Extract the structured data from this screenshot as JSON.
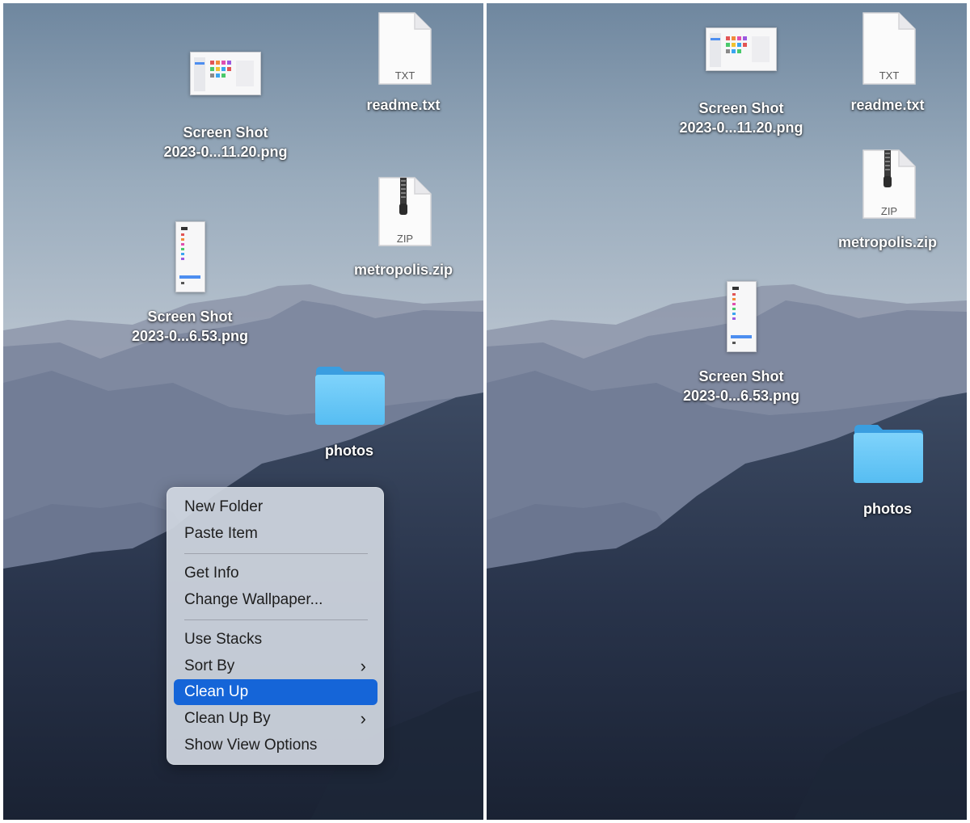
{
  "desktop_icons": {
    "screenshot_1": {
      "name_line1": "Screen Shot",
      "name_line2": "2023-0...11.20.png"
    },
    "screenshot_2": {
      "name_line1": "Screen Shot",
      "name_line2": "2023-0...6.53.png"
    },
    "readme": {
      "name": "readme.txt",
      "ext": "TXT"
    },
    "zip": {
      "name": "metropolis.zip",
      "ext": "ZIP"
    },
    "folder": {
      "name": "photos"
    }
  },
  "context_menu": {
    "new_folder": "New Folder",
    "paste_item": "Paste Item",
    "get_info": "Get Info",
    "change_wallpaper": "Change Wallpaper...",
    "use_stacks": "Use Stacks",
    "sort_by": "Sort By",
    "clean_up": "Clean Up",
    "clean_up_by": "Clean Up By",
    "show_view_options": "Show View Options",
    "submenu_chevron": "›",
    "highlighted_item": "Clean Up"
  },
  "colors": {
    "highlight": "#1565d8",
    "folder": "#5ac1f5"
  }
}
